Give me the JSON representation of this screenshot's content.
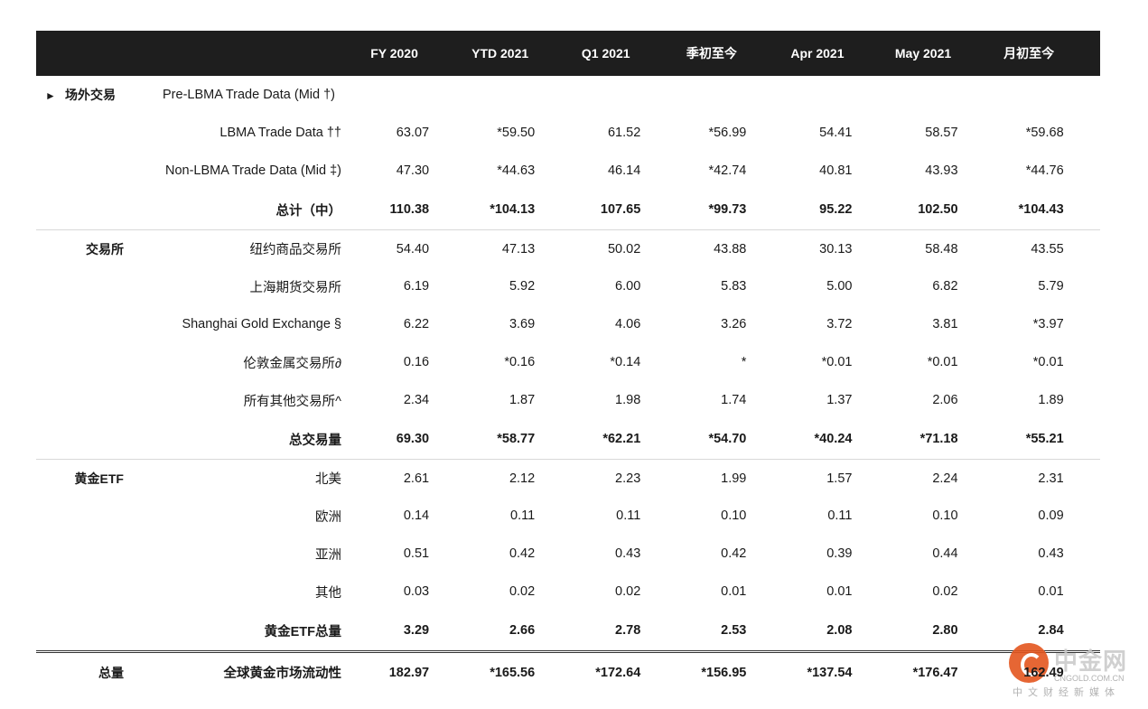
{
  "columns": [
    "FY 2020",
    "YTD 2021",
    "Q1 2021",
    "季初至今",
    "Apr 2021",
    "May 2021",
    "月初至今"
  ],
  "otc": {
    "section": "场外交易",
    "arrow": "►",
    "pre_label": "Pre-LBMA Trade Data (Mid †)",
    "rows": [
      {
        "label": "LBMA Trade Data ††",
        "values": [
          "63.07",
          "*59.50",
          "61.52",
          "*56.99",
          "54.41",
          "58.57",
          "*59.68"
        ]
      },
      {
        "label": "Non-LBMA Trade Data (Mid ‡)",
        "values": [
          "47.30",
          "*44.63",
          "46.14",
          "*42.74",
          "40.81",
          "43.93",
          "*44.76"
        ]
      }
    ],
    "total": {
      "label": "总计（中）",
      "values": [
        "110.38",
        "*104.13",
        "107.65",
        "*99.73",
        "95.22",
        "102.50",
        "*104.43"
      ]
    }
  },
  "exchanges": {
    "section": "交易所",
    "rows": [
      {
        "label": "纽约商品交易所",
        "values": [
          "54.40",
          "47.13",
          "50.02",
          "43.88",
          "30.13",
          "58.48",
          "43.55"
        ]
      },
      {
        "label": "上海期货交易所",
        "values": [
          "6.19",
          "5.92",
          "6.00",
          "5.83",
          "5.00",
          "6.82",
          "5.79"
        ]
      },
      {
        "label": "Shanghai Gold Exchange §",
        "values": [
          "6.22",
          "3.69",
          "4.06",
          "3.26",
          "3.72",
          "3.81",
          "*3.97"
        ]
      },
      {
        "label": "伦敦金属交易所∂",
        "values": [
          "0.16",
          "*0.16",
          "*0.14",
          "*",
          "*0.01",
          "*0.01",
          "*0.01"
        ]
      },
      {
        "label": "所有其他交易所^",
        "values": [
          "2.34",
          "1.87",
          "1.98",
          "1.74",
          "1.37",
          "2.06",
          "1.89"
        ]
      }
    ],
    "total": {
      "label": "总交易量",
      "values": [
        "69.30",
        "*58.77",
        "*62.21",
        "*54.70",
        "*40.24",
        "*71.18",
        "*55.21"
      ]
    }
  },
  "etf": {
    "section": "黄金ETF",
    "rows": [
      {
        "label": "北美",
        "values": [
          "2.61",
          "2.12",
          "2.23",
          "1.99",
          "1.57",
          "2.24",
          "2.31"
        ]
      },
      {
        "label": "欧洲",
        "values": [
          "0.14",
          "0.11",
          "0.11",
          "0.10",
          "0.11",
          "0.10",
          "0.09"
        ]
      },
      {
        "label": "亚洲",
        "values": [
          "0.51",
          "0.42",
          "0.43",
          "0.42",
          "0.39",
          "0.44",
          "0.43"
        ]
      },
      {
        "label": "其他",
        "values": [
          "0.03",
          "0.02",
          "0.02",
          "0.01",
          "0.01",
          "0.02",
          "0.01"
        ]
      }
    ],
    "total": {
      "label": "黄金ETF总量",
      "values": [
        "3.29",
        "2.66",
        "2.78",
        "2.53",
        "2.08",
        "2.80",
        "2.84"
      ]
    }
  },
  "grand": {
    "section": "总量",
    "label": "全球黄金市场流动性",
    "values": [
      "182.97",
      "*165.56",
      "*172.64",
      "*156.95",
      "*137.54",
      "*176.47",
      "162.49"
    ]
  },
  "watermark": {
    "name": "中金网",
    "url": "CNGOLD.COM.CN",
    "tagline": "中文财经新媒体"
  },
  "colors": {
    "header_bg": "#1e1e1e",
    "total_bg": "#9e8a63",
    "stripe": "#f0f0f0"
  }
}
